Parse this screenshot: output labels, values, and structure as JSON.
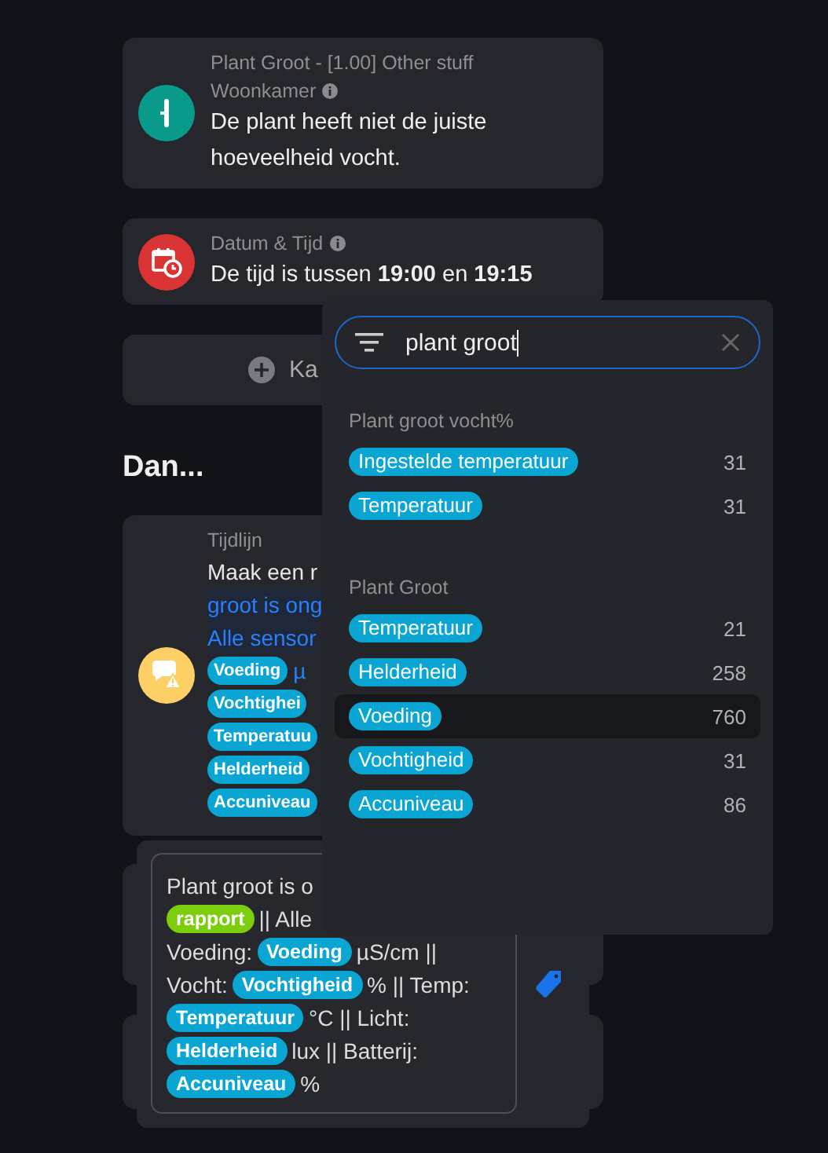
{
  "conditions": [
    {
      "kind": "device",
      "color": "#0a9a8c",
      "title": "Plant Groot - [1.00] Other stuff",
      "subtitle": "Woonkamer",
      "body": "De plant heeft niet de juiste hoeveelheid vocht."
    },
    {
      "kind": "time",
      "color": "#db3434",
      "title": "Datum & Tijd",
      "body": "De tijd is tussen **19:00** en **19:15**"
    }
  ],
  "add_button": {
    "label": "Ka"
  },
  "then_heading": "Dan...",
  "action": {
    "kind": "timeline",
    "color": "#fcd065",
    "title": "Tijdlijn",
    "lines": [
      {
        "kind": "text",
        "text": "Maak een r"
      },
      {
        "kind": "link",
        "text": "groot is ong"
      },
      {
        "kind": "link",
        "text": "Alle sensor"
      },
      {
        "kind": "chip",
        "chip": "Voeding",
        "after": "µ"
      },
      {
        "kind": "chip",
        "chip": "Vochtighei"
      },
      {
        "kind": "chip",
        "chip": "Temperatuu"
      },
      {
        "kind": "chip",
        "chip": "Helderheid"
      },
      {
        "kind": "chip",
        "chip": "Accuniveau"
      }
    ]
  },
  "editor": {
    "lines": [
      {
        "parts": [
          {
            "kind": "text",
            "text": "Plant groot is o"
          }
        ]
      },
      {
        "parts": [
          {
            "kind": "tag",
            "text": "rapport",
            "color": "#7cce0c"
          },
          {
            "kind": "text",
            "text": "|| Alle"
          }
        ]
      },
      {
        "parts": [
          {
            "kind": "text",
            "text": "Voeding:"
          },
          {
            "kind": "tag",
            "text": "Voeding",
            "color": "#0aa5d3"
          },
          {
            "kind": "text",
            "text": "µS/cm ||"
          }
        ]
      },
      {
        "parts": [
          {
            "kind": "text",
            "text": "Vocht:"
          },
          {
            "kind": "tag",
            "text": "Vochtigheid",
            "color": "#0aa5d3"
          },
          {
            "kind": "text",
            "text": "% || Temp:"
          }
        ]
      },
      {
        "parts": [
          {
            "kind": "tag",
            "text": "Temperatuur",
            "color": "#0aa5d3"
          },
          {
            "kind": "text",
            "text": "°C || Licht:"
          }
        ]
      },
      {
        "parts": [
          {
            "kind": "tag",
            "text": "Helderheid",
            "color": "#0aa5d3"
          },
          {
            "kind": "text",
            "text": "lux || Batterij:"
          }
        ]
      },
      {
        "parts": [
          {
            "kind": "tag",
            "text": "Accuniveau",
            "color": "#0aa5d3"
          },
          {
            "kind": "text",
            "text": "%"
          }
        ]
      }
    ]
  },
  "token_picker": {
    "search": {
      "value": "plant groot"
    },
    "groups": [
      {
        "title": "Plant groot vocht%",
        "items": [
          {
            "label": "Ingestelde temperatuur",
            "value": "31",
            "selected": false
          },
          {
            "label": "Temperatuur",
            "value": "31",
            "selected": false
          }
        ]
      },
      {
        "title": "Plant Groot",
        "items": [
          {
            "label": "Temperatuur",
            "value": "21",
            "selected": false
          },
          {
            "label": "Helderheid",
            "value": "258",
            "selected": false
          },
          {
            "label": "Voeding",
            "value": "760",
            "selected": true
          },
          {
            "label": "Vochtigheid",
            "value": "31",
            "selected": false
          },
          {
            "label": "Accuniveau",
            "value": "86",
            "selected": false
          }
        ]
      }
    ]
  }
}
